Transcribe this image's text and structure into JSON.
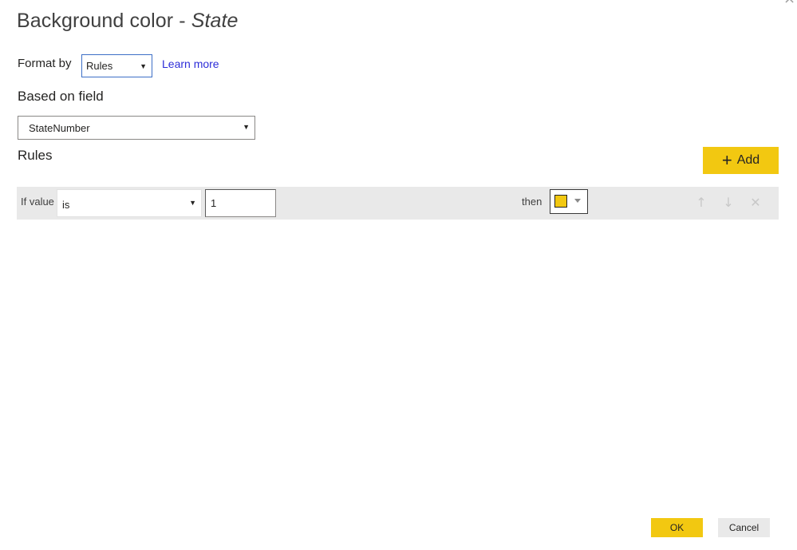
{
  "dialog": {
    "title_main": "Background color - ",
    "title_field": "State",
    "close_icon": "×"
  },
  "format_by": {
    "label": "Format by",
    "selected": "Rules",
    "learn_more": "Learn more"
  },
  "based_on_field": {
    "label": "Based on field",
    "selected": "StateNumber"
  },
  "rules": {
    "label": "Rules",
    "add_label": "Add",
    "add_icon": "+",
    "items": [
      {
        "if_label": "If value",
        "operator": "is",
        "value": "1",
        "then_label": "then",
        "color": "#f2c811",
        "move_up_icon": "↑",
        "move_down_icon": "↓",
        "delete_icon": "✕"
      }
    ]
  },
  "footer": {
    "ok_label": "OK",
    "cancel_label": "Cancel"
  },
  "icons": {
    "caret": "▼"
  }
}
